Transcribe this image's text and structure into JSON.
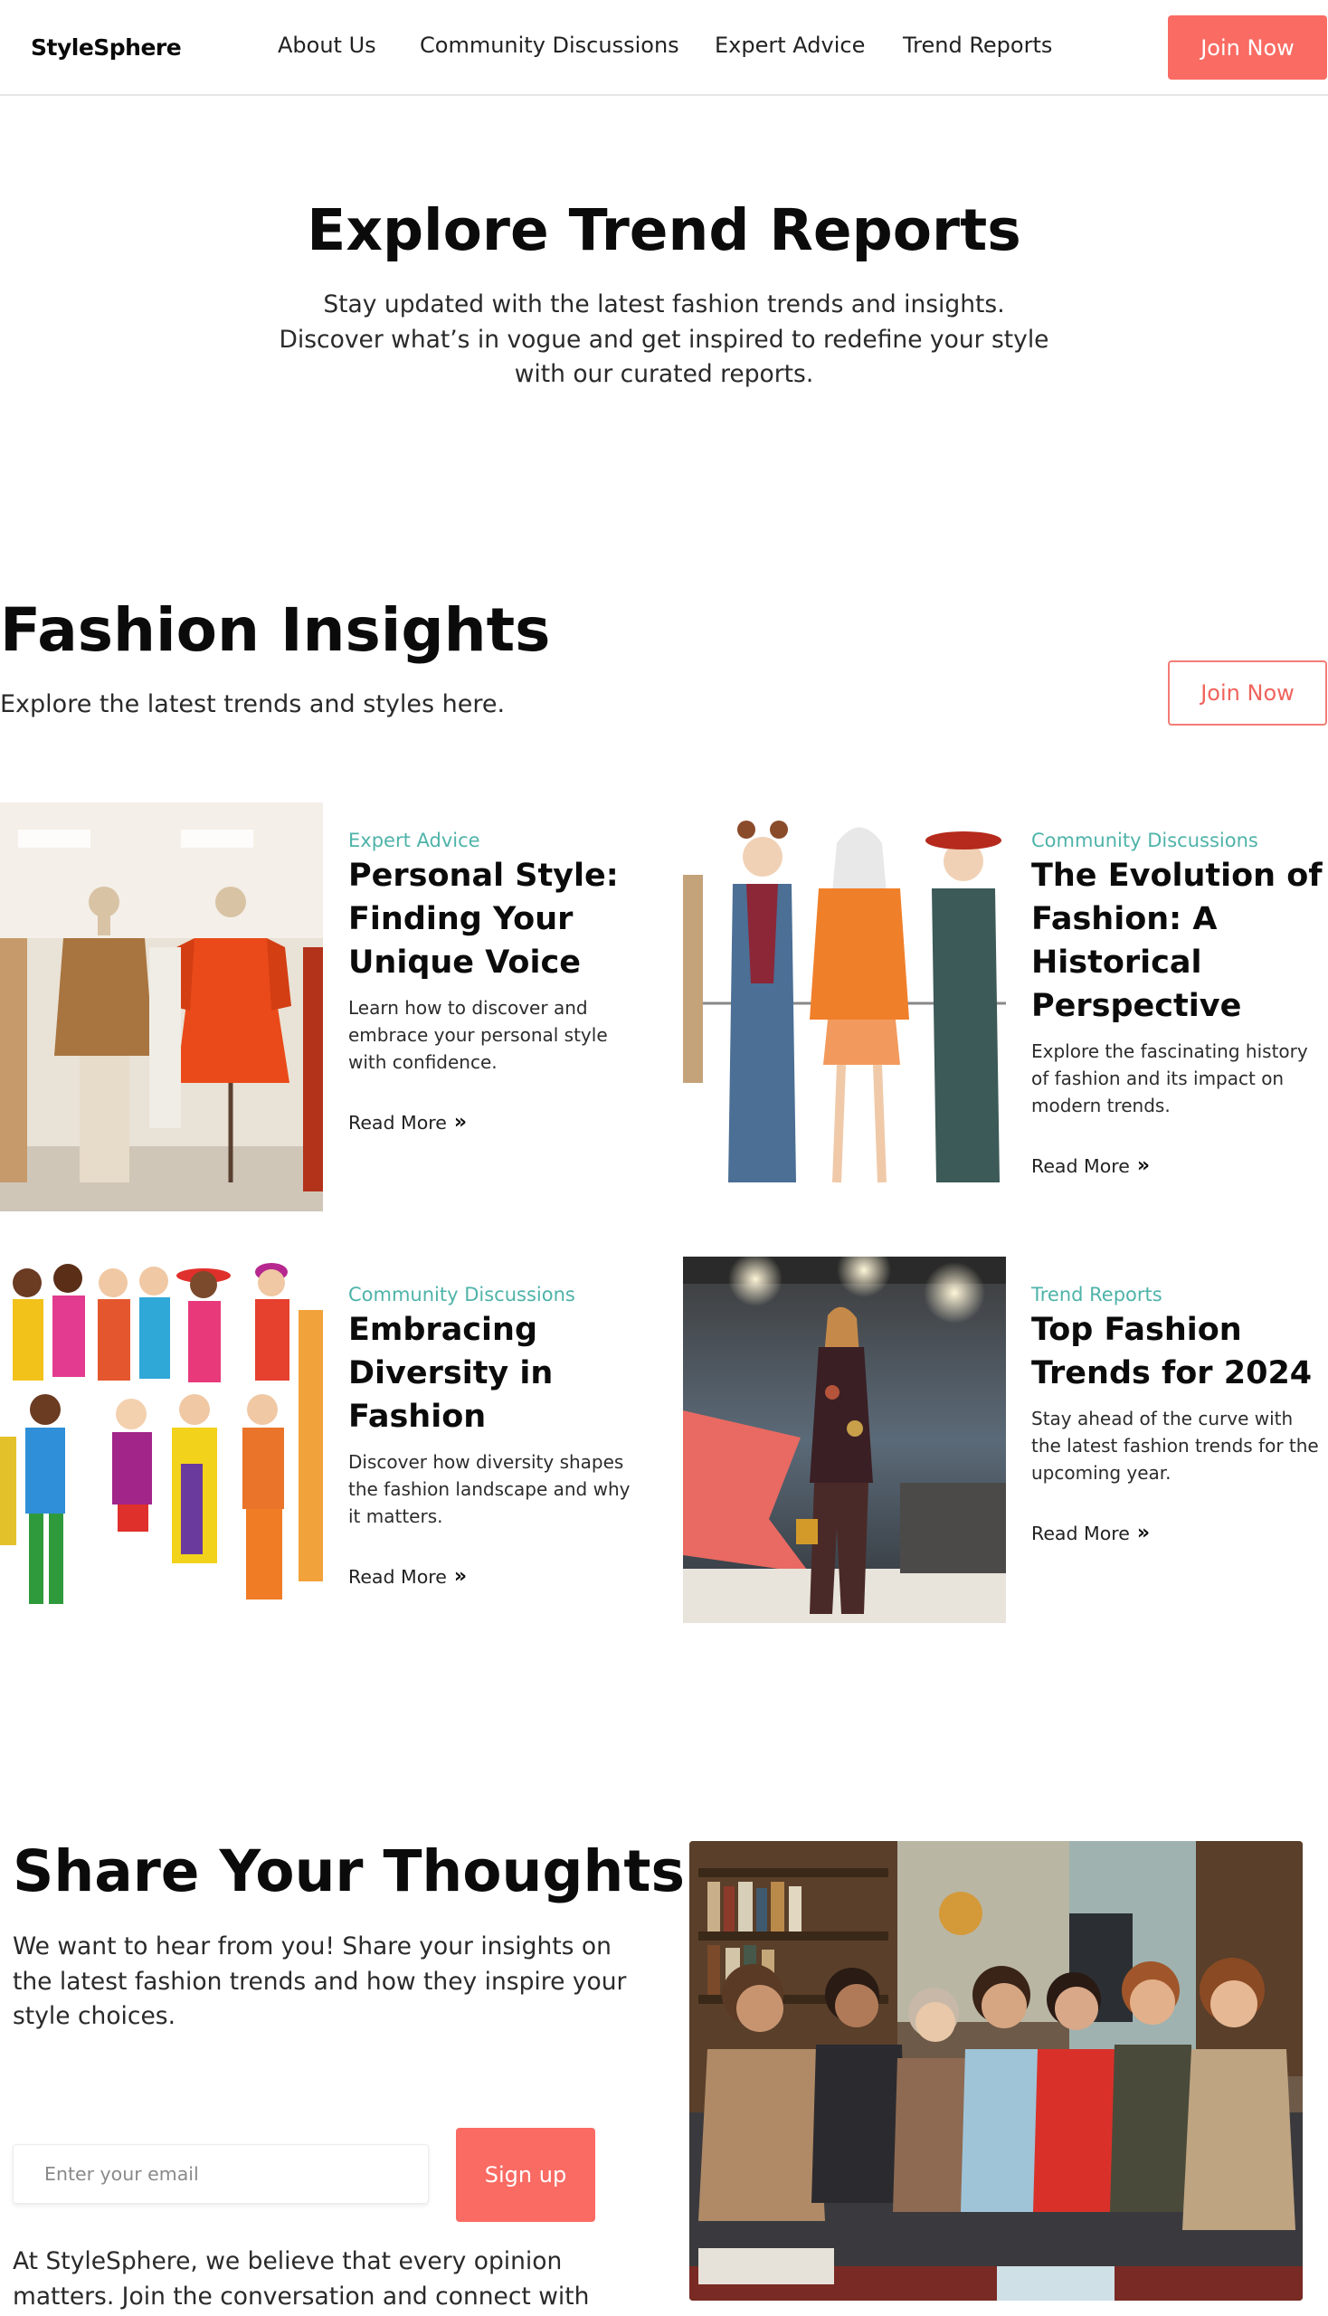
{
  "nav": {
    "logo": "StyleSphere",
    "links": [
      "About Us",
      "Community Discussions",
      "Expert Advice",
      "Trend Reports"
    ],
    "cta": "Join Now"
  },
  "hero": {
    "title": "Explore Trend Reports",
    "subtitle": "Stay updated with the latest fashion trends and insights. Discover what’s in vogue and get inspired to redefine your style with our curated reports."
  },
  "insights": {
    "title": "Fashion Insights",
    "subtitle": "Explore the latest trends and styles here.",
    "cta": "Join Now",
    "cards": [
      {
        "category": "Expert Advice",
        "title": "Personal Style: Finding Your Unique Voice",
        "description": "Learn how to discover and embrace your personal style with confidence.",
        "link": "Read More",
        "image_icon": "mannequins-image"
      },
      {
        "category": "Community Discussions",
        "title": "The Evolution of Fashion: A Historical Perspective",
        "description": "Explore the fascinating history of fashion and its impact on modern trends.",
        "link": "Read More",
        "image_icon": "illustrated-models-image"
      },
      {
        "category": "Community Discussions",
        "title": "Embracing Diversity in Fashion",
        "description": "Discover how diversity shapes the fashion landscape and why it matters.",
        "link": "Read More",
        "image_icon": "diverse-crowd-image"
      },
      {
        "category": "Trend Reports",
        "title": "Top Fashion Trends for 2024",
        "description": "Stay ahead of the curve with the latest fashion trends for the upcoming year.",
        "link": "Read More",
        "image_icon": "runway-image"
      }
    ]
  },
  "share": {
    "title": "Share Your Thoughts",
    "subtitle": "We want to hear from you! Share your insights on the latest fashion trends and how they inspire your style choices.",
    "email_placeholder": "Enter your email",
    "button": "Sign up",
    "footer_text": "At StyleSphere, we believe that every opinion matters. Join the conversation and connect with fellow fashion",
    "image_icon": "community-group-image"
  },
  "colors": {
    "accent": "#fa6b63",
    "category": "#4fb3a9",
    "text": "#0b0b0b"
  }
}
